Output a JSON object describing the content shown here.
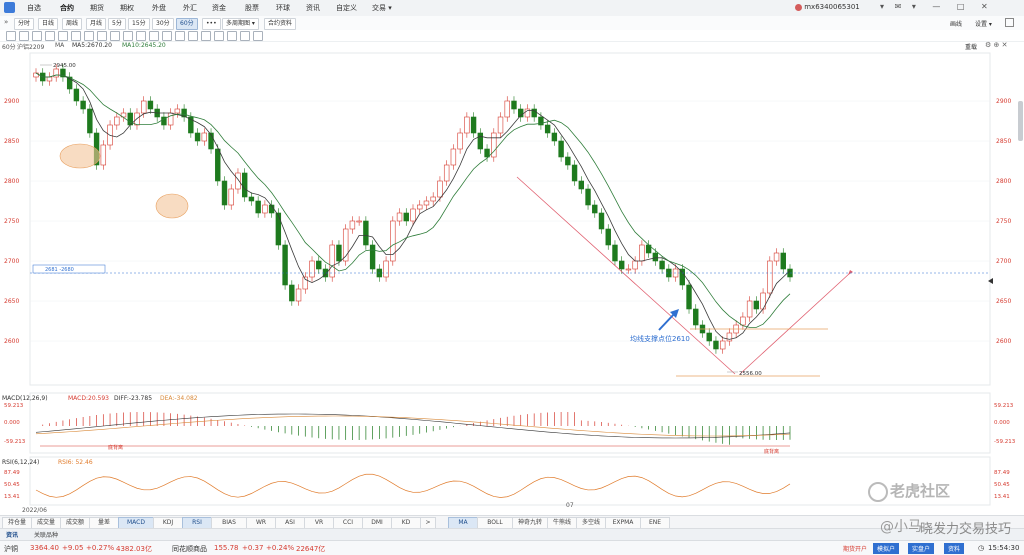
{
  "nav": {
    "tabs": [
      "自选",
      "合约",
      "期货",
      "期权",
      "外盘",
      "外汇",
      "资金",
      "股票",
      "环球",
      "资讯",
      "自定义",
      "交易 ▾"
    ],
    "active_index": 1
  },
  "account": {
    "user": "mx6340065301",
    "menu": [
      "▾",
      "✉",
      "▾",
      "—",
      "□",
      "✕"
    ]
  },
  "periods": {
    "items": [
      "分时",
      "日线",
      "周线",
      "月线",
      "5分",
      "15分",
      "30分",
      "60分"
    ],
    "active_index": 7,
    "more": "•••",
    "multi": "多周期图 ▾",
    "contract_info": "合约资料"
  },
  "right_tools": {
    "draw": "画线",
    "setting": "设置 ▾"
  },
  "chart_header": {
    "period": "60分",
    "symbol": "沪铝2209",
    "ma_label": "MA",
    "ma5": "MA5:2670.20",
    "ma10": "MA10:2645.20",
    "restore": "重载"
  },
  "colors": {
    "up": "#d63b30",
    "down": "#1e7a1e",
    "ma5": "#3a3a3a",
    "ma10": "#2f7d3a",
    "macd_dif": "#333333",
    "macd_dea": "#d98a3a",
    "rsi": "#e07b2b",
    "annot": "#e06070",
    "arrow": "#2f6fd0",
    "highlight": "#f3c59a"
  },
  "chart_data": {
    "type": "candlestick",
    "xlabels": [
      "2022/06",
      "07"
    ],
    "yticks": [
      2600,
      2650,
      2700,
      2750,
      2800,
      2850,
      2900
    ],
    "price_marker": "2681 -2680",
    "max_label": "2945.00",
    "min_label": "2556.00",
    "annotation": "均线支撑点位2610",
    "macd": {
      "label": "MACD(12,26,9)",
      "macd": "MACD:20.593",
      "diff": "DIFF:-23.785",
      "dea": "DEA:-34.082",
      "ticks": [
        "59.213",
        "0.000",
        "-59.213"
      ],
      "note1": "底背离",
      "note2": "底背离"
    },
    "rsi": {
      "label": "RSI(6,12,24)",
      "rsi6": "RSI6: 52.46",
      "ticks": [
        "87.49",
        "50.45",
        "13.41"
      ]
    }
  },
  "bottom_tabs": [
    "持仓量",
    "成交量",
    "成交额",
    "量差",
    "MACD",
    "KDJ",
    "RSI",
    "BIAS",
    "WR",
    "ASI",
    "VR",
    "CCI",
    "DMI",
    "KD",
    ">",
    "MA",
    "BOLL",
    "神奇九转",
    "牛熊线",
    "多空线",
    "EXPMA",
    "ENE"
  ],
  "bottom_active": [
    "MACD",
    "RSI",
    "MA"
  ],
  "info_tabs": [
    "资讯",
    "关联品种"
  ],
  "status": {
    "idx1_name": "沪铜",
    "idx1_val": "3364.40",
    "idx1_chg": "+9.05",
    "idx1_pct": "+0.27%",
    "idx1_vol": "4382.03亿",
    "idx2_name": "同花顺商品",
    "idx2_val": "155.78",
    "idx2_chg": "+0.37",
    "idx2_pct": "+0.24%",
    "idx2_vol": "22647亿",
    "open": "期货开户",
    "btn1": "模拟户",
    "btn2": "实盘户",
    "btn3": "资料",
    "time": "15:54:30"
  },
  "watermark": {
    "text1": "老虎社区",
    "text2": "@小马",
    "text3": "晓发力交易技巧"
  }
}
